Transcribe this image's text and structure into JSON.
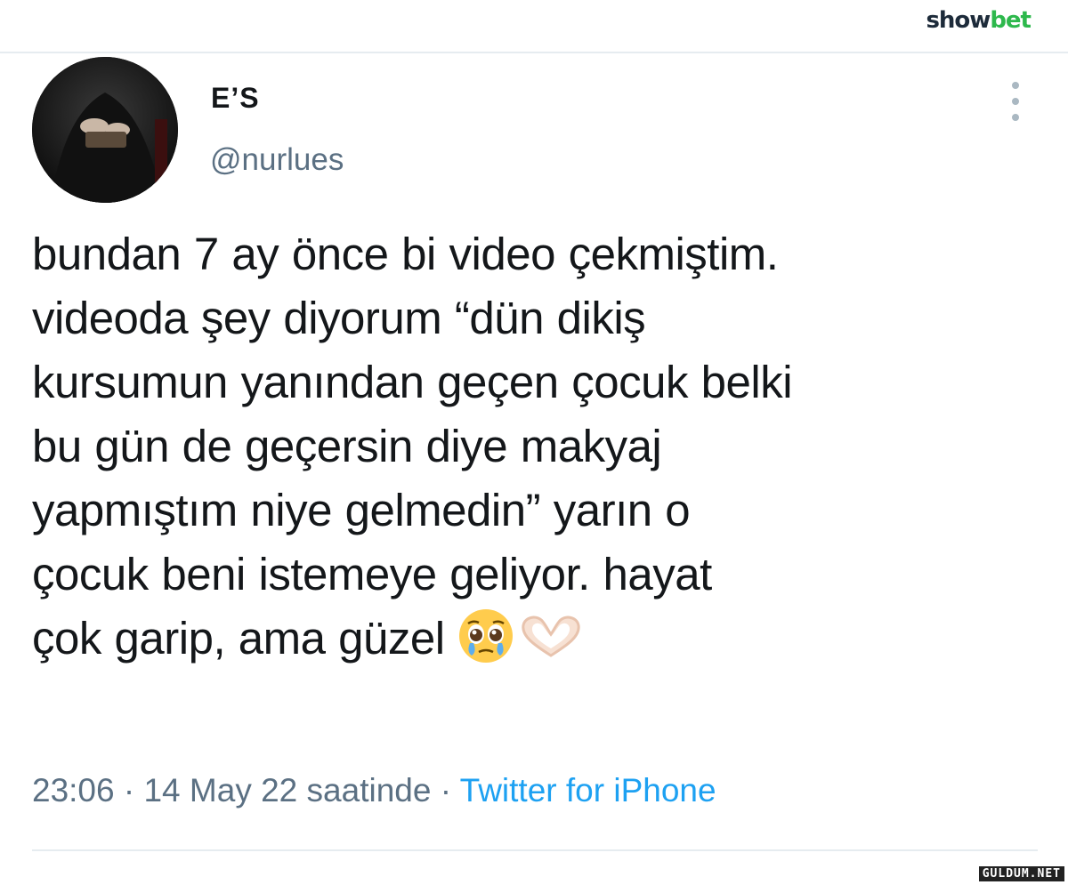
{
  "watermark": {
    "brand_part1": "show",
    "brand_part2": "bet",
    "site": "GULDUM.NET"
  },
  "tweet": {
    "display_name": "E’S",
    "handle": "@nurlues",
    "avatar": "avatar-photo",
    "text_lines": [
      "bundan 7 ay önce bi video çekmiştim.",
      "videoda şey diyorum “dün dikiş",
      "kursumun yanından geçen çocuk belki",
      "bu gün de geçersin diye makyaj",
      "yapmıştım niye gelmedin” yarın o",
      "çocuk beni istemeye geliyor. hayat",
      "çok garip, ama güzel"
    ],
    "emojis": [
      "pleading-face-with-tear-emoji",
      "heart-hands-emoji"
    ],
    "time": "23:06",
    "separator": "·",
    "date_label": "14 May 22 saatinde",
    "source": "Twitter for iPhone"
  },
  "colors": {
    "text": "#14171a",
    "secondary": "#5b7083",
    "link": "#1da1f2",
    "divider": "#e6ecf0",
    "brand_dark": "#1d2b3a",
    "brand_green": "#2db84c"
  }
}
